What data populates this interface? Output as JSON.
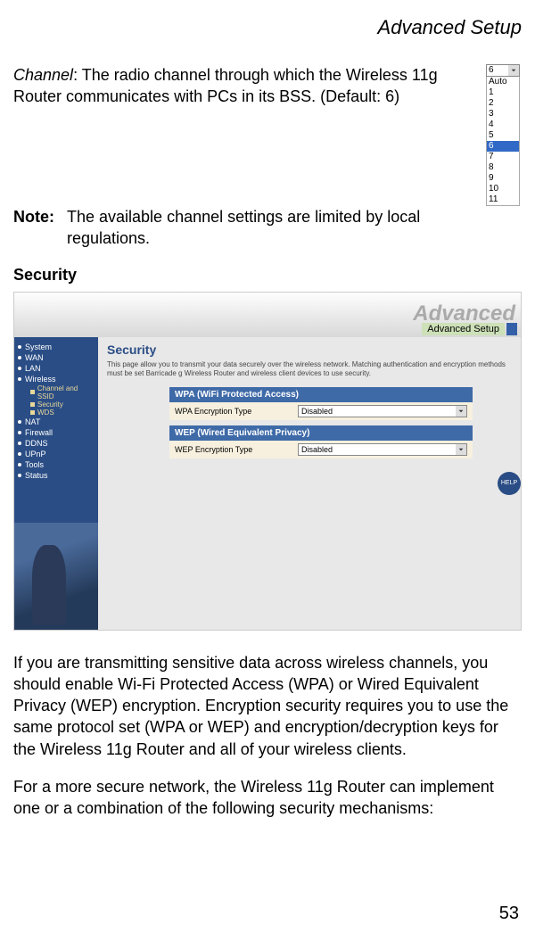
{
  "header": {
    "title": "Advanced Setup"
  },
  "channel_para": {
    "term": "Channel",
    "rest": ": The radio channel through which the Wireless 11g Router communicates with PCs in its BSS. (Default: 6)"
  },
  "dropdown": {
    "selected": "6",
    "options": [
      "Auto",
      "1",
      "2",
      "3",
      "4",
      "5",
      "6",
      "7",
      "8",
      "9",
      "10",
      "11"
    ],
    "highlight_index": 6
  },
  "note": {
    "label": "Note:",
    "text": "The available channel settings are limited by local regulations."
  },
  "security_heading": "Security",
  "screenshot": {
    "brand": "Advanced",
    "tab": "Advanced Setup",
    "sidebar": {
      "items": [
        "System",
        "WAN",
        "LAN",
        "Wireless"
      ],
      "sub": [
        "Channel and SSID",
        "Security",
        "WDS"
      ],
      "items2": [
        "NAT",
        "Firewall",
        "DDNS",
        "UPnP",
        "Tools",
        "Status"
      ]
    },
    "main": {
      "heading": "Security",
      "desc": "This page allow you to transmit your data securely over the wireless network. Matching authentication and encryption methods must be set Barricade g Wireless Router and wireless client devices to use security.",
      "wpa_bar": "WPA (WiFi Protected Access)",
      "wpa_label": "WPA Encryption Type",
      "wpa_value": "Disabled",
      "wep_bar": "WEP (Wired Equivalent Privacy)",
      "wep_label": "WEP Encryption Type",
      "wep_value": "Disabled",
      "help": "HELP"
    }
  },
  "body_para1": "If you are transmitting sensitive data across wireless channels, you should enable Wi-Fi Protected Access (WPA) or Wired Equivalent Privacy (WEP) encryption. Encryption security requires you to use the same protocol set (WPA or WEP) and encryption/decryption keys for the Wireless 11g Router and all of your wireless clients.",
  "body_para2": "For a more secure network, the Wireless 11g Router can implement one or a combination of the following security mechanisms:",
  "page_number": "53"
}
